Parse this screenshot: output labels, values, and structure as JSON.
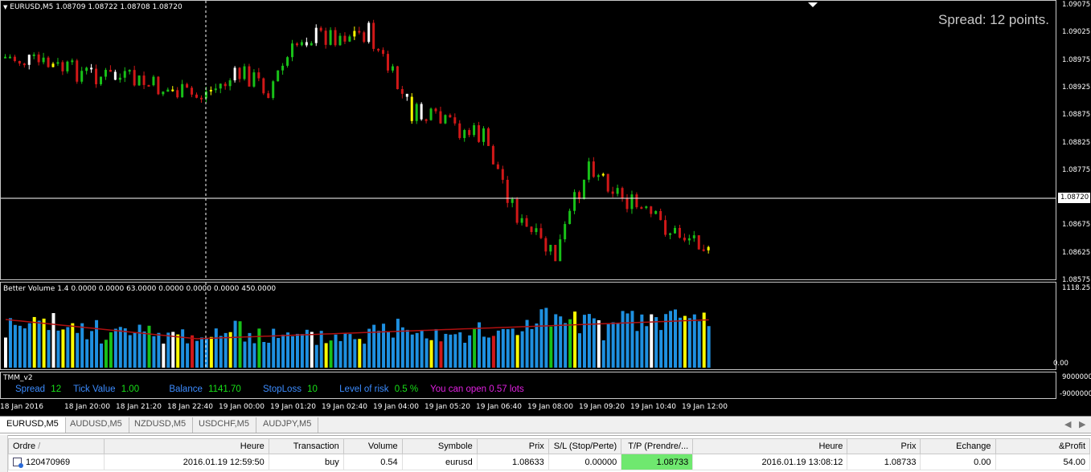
{
  "chart": {
    "symbol_label": "EURUSD,M5  1.08709 1.08722 1.08708 1.08720",
    "spread_text": "Spread: 12 points.",
    "current_price": "1.08720",
    "price_axis": [
      "1.09075",
      "1.09025",
      "1.08975",
      "1.08925",
      "1.08875",
      "1.08825",
      "1.08775",
      "1.08725",
      "1.08675",
      "1.08625",
      "1.08575"
    ],
    "colors": {
      "background": "#000000",
      "bull": "#18c018",
      "bear": "#d01818",
      "climax": "#ffffff",
      "low_volume": "#ffff00",
      "volume": "#1e90e0",
      "ma": "#b01010"
    }
  },
  "volume": {
    "label": "Better Volume 1.4 0.0000 0.0000 63.0000 0.0000 0.0000 0.0000 450.0000",
    "axis_top": "1118.25",
    "axis_bottom": "0.00"
  },
  "tmm": {
    "label": "TMM_v2",
    "axis_top": "9000000",
    "axis_bottom": "-9000000",
    "spread_label": "Spread",
    "spread_value": "12",
    "tick_label": "Tick Value",
    "tick_value": "1.00",
    "balance_label": "Balance",
    "balance_value": "1141.70",
    "stoploss_label": "StopLoss",
    "stoploss_value": "10",
    "risk_label": "Level of risk",
    "risk_value": "0.5 %",
    "lots_text": "You can open 0.57 lots"
  },
  "time_axis": [
    "18 Jan 2016",
    "18 Jan 20:00",
    "18 Jan 21:20",
    "18 Jan 22:40",
    "19 Jan 00:00",
    "19 Jan 01:20",
    "19 Jan 02:40",
    "19 Jan 04:00",
    "19 Jan 05:20",
    "19 Jan 06:40",
    "19 Jan 08:00",
    "19 Jan 09:20",
    "19 Jan 10:40",
    "19 Jan 12:00"
  ],
  "tabs": [
    "EURUSD,M5",
    "AUDUSD,M5",
    "NZDUSD,M5",
    "USDCHF,M5",
    "AUDJPY,M5"
  ],
  "terminal": {
    "headers": [
      "Ordre",
      "Heure",
      "Transaction",
      "Volume",
      "Symbole",
      "Prix",
      "S/L (Stop/Perte)",
      "T/P (Prendre/...",
      "Heure",
      "Prix",
      "Echange",
      "&Profit"
    ],
    "row": [
      "120470969",
      "2016.01.19 12:59:50",
      "buy",
      "0.54",
      "eurusd",
      "1.08633",
      "0.00000",
      "1.08733",
      "2016.01.19 13:08:12",
      "1.08733",
      "0.00",
      "54.00"
    ]
  }
}
